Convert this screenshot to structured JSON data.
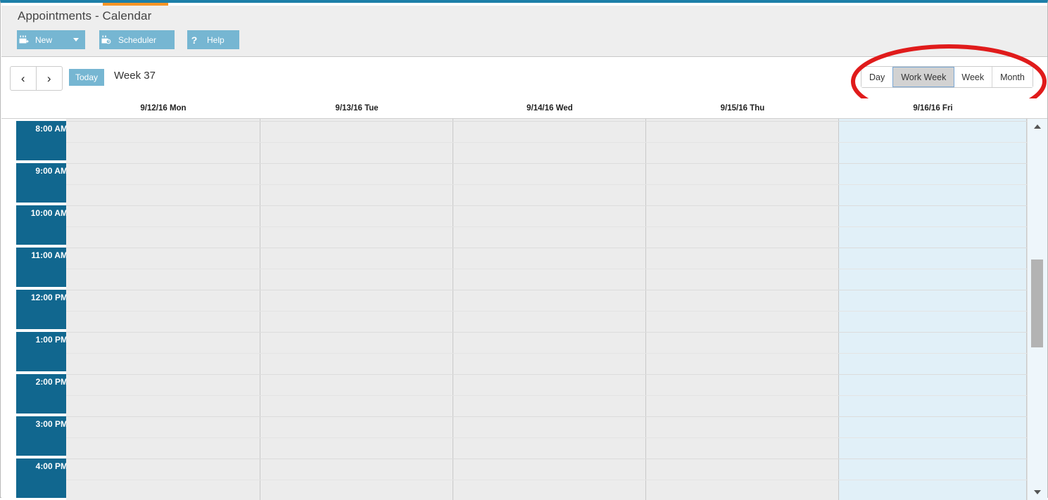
{
  "window": {
    "title": "Appointments - Calendar",
    "accent_blue": "#1c7fa8",
    "tab_accent_orange": "#f79425"
  },
  "toolbar": {
    "new": {
      "label": "New",
      "icon": "calendar-plus-icon",
      "has_dropdown": true
    },
    "scheduler": {
      "label": "Scheduler",
      "icon": "calendar-clock-icon"
    },
    "help": {
      "label": "Help",
      "icon": "question-mark-icon"
    },
    "button_color": "#76b6d2"
  },
  "navbar": {
    "prev_label": "‹",
    "next_label": "›",
    "today_label": "Today",
    "period_label": "Week 37"
  },
  "view_switcher": {
    "selected": "Work Week",
    "options": [
      {
        "label": "Day",
        "selected": false
      },
      {
        "label": "Work Week",
        "selected": true
      },
      {
        "label": "Week",
        "selected": false
      },
      {
        "label": "Month",
        "selected": false
      }
    ]
  },
  "annotation": {
    "shape": "ellipse",
    "color": "#e01b1b",
    "target": "view-switcher"
  },
  "calendar": {
    "days": [
      {
        "label": "9/12/16 Mon",
        "today": false
      },
      {
        "label": "9/13/16 Tue",
        "today": false
      },
      {
        "label": "9/14/16 Wed",
        "today": false
      },
      {
        "label": "9/15/16 Thu",
        "today": false
      },
      {
        "label": "9/16/16 Fri",
        "today": true
      }
    ],
    "times": [
      "8:00 AM",
      "9:00 AM",
      "10:00 AM",
      "11:00 AM",
      "12:00 PM",
      "1:00 PM",
      "2:00 PM",
      "3:00 PM",
      "4:00 PM"
    ],
    "time_gutter_color": "#11678f",
    "today_column_color": "#e1f0f8",
    "grid_color": "#ececec",
    "appointments": []
  },
  "scrollbar": {
    "up_arrow": "▲",
    "down_arrow": "▼",
    "orientation": "vertical"
  }
}
